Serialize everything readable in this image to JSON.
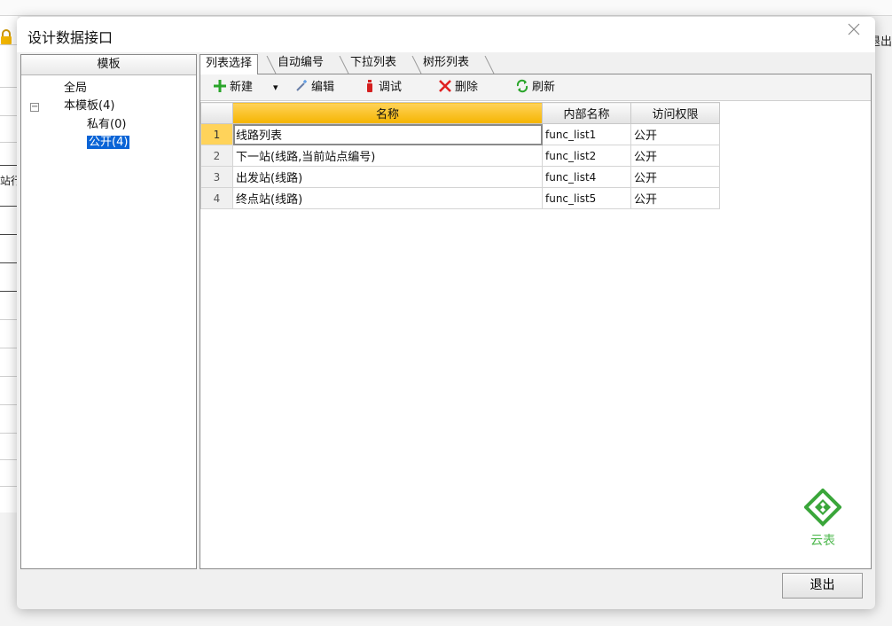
{
  "background": {
    "left_cut_text": "站行",
    "right_cut_text": "退出"
  },
  "dialog": {
    "title": "设计数据接口",
    "exit_label": "退出",
    "brand_text": "云表"
  },
  "tree": {
    "header": "模板",
    "items": [
      {
        "label": "全局"
      },
      {
        "label": "本模板(4)",
        "expanded_symbol": "⊟"
      },
      {
        "label": "私有(0)"
      },
      {
        "label": "公开(4)",
        "selected": true
      }
    ]
  },
  "tabs": [
    {
      "label": "列表选择",
      "active": true
    },
    {
      "label": "自动编号"
    },
    {
      "label": "下拉列表"
    },
    {
      "label": "树形列表"
    }
  ],
  "toolbar": {
    "new_label": "新建",
    "dropdown_arrow": "▾",
    "edit_label": "编辑",
    "debug_label": "调试",
    "delete_label": "删除",
    "refresh_label": "刷新"
  },
  "grid": {
    "columns": [
      "名称",
      "内部名称",
      "访问权限"
    ],
    "rows": [
      {
        "num": "1",
        "name": "线路列表",
        "inner": "func_list1",
        "access": "公开"
      },
      {
        "num": "2",
        "name": "下一站(线路,当前站点编号)",
        "inner": "func_list2",
        "access": "公开"
      },
      {
        "num": "3",
        "name": "出发站(线路)",
        "inner": "func_list4",
        "access": "公开"
      },
      {
        "num": "4",
        "name": "终点站(线路)",
        "inner": "func_list5",
        "access": "公开"
      }
    ]
  },
  "colors": {
    "selection": "#0a64d6",
    "header_highlight": "#f5b400",
    "brand_green": "#4eb84e",
    "add_green": "#2aa52a",
    "delete_red": "#e02020"
  }
}
